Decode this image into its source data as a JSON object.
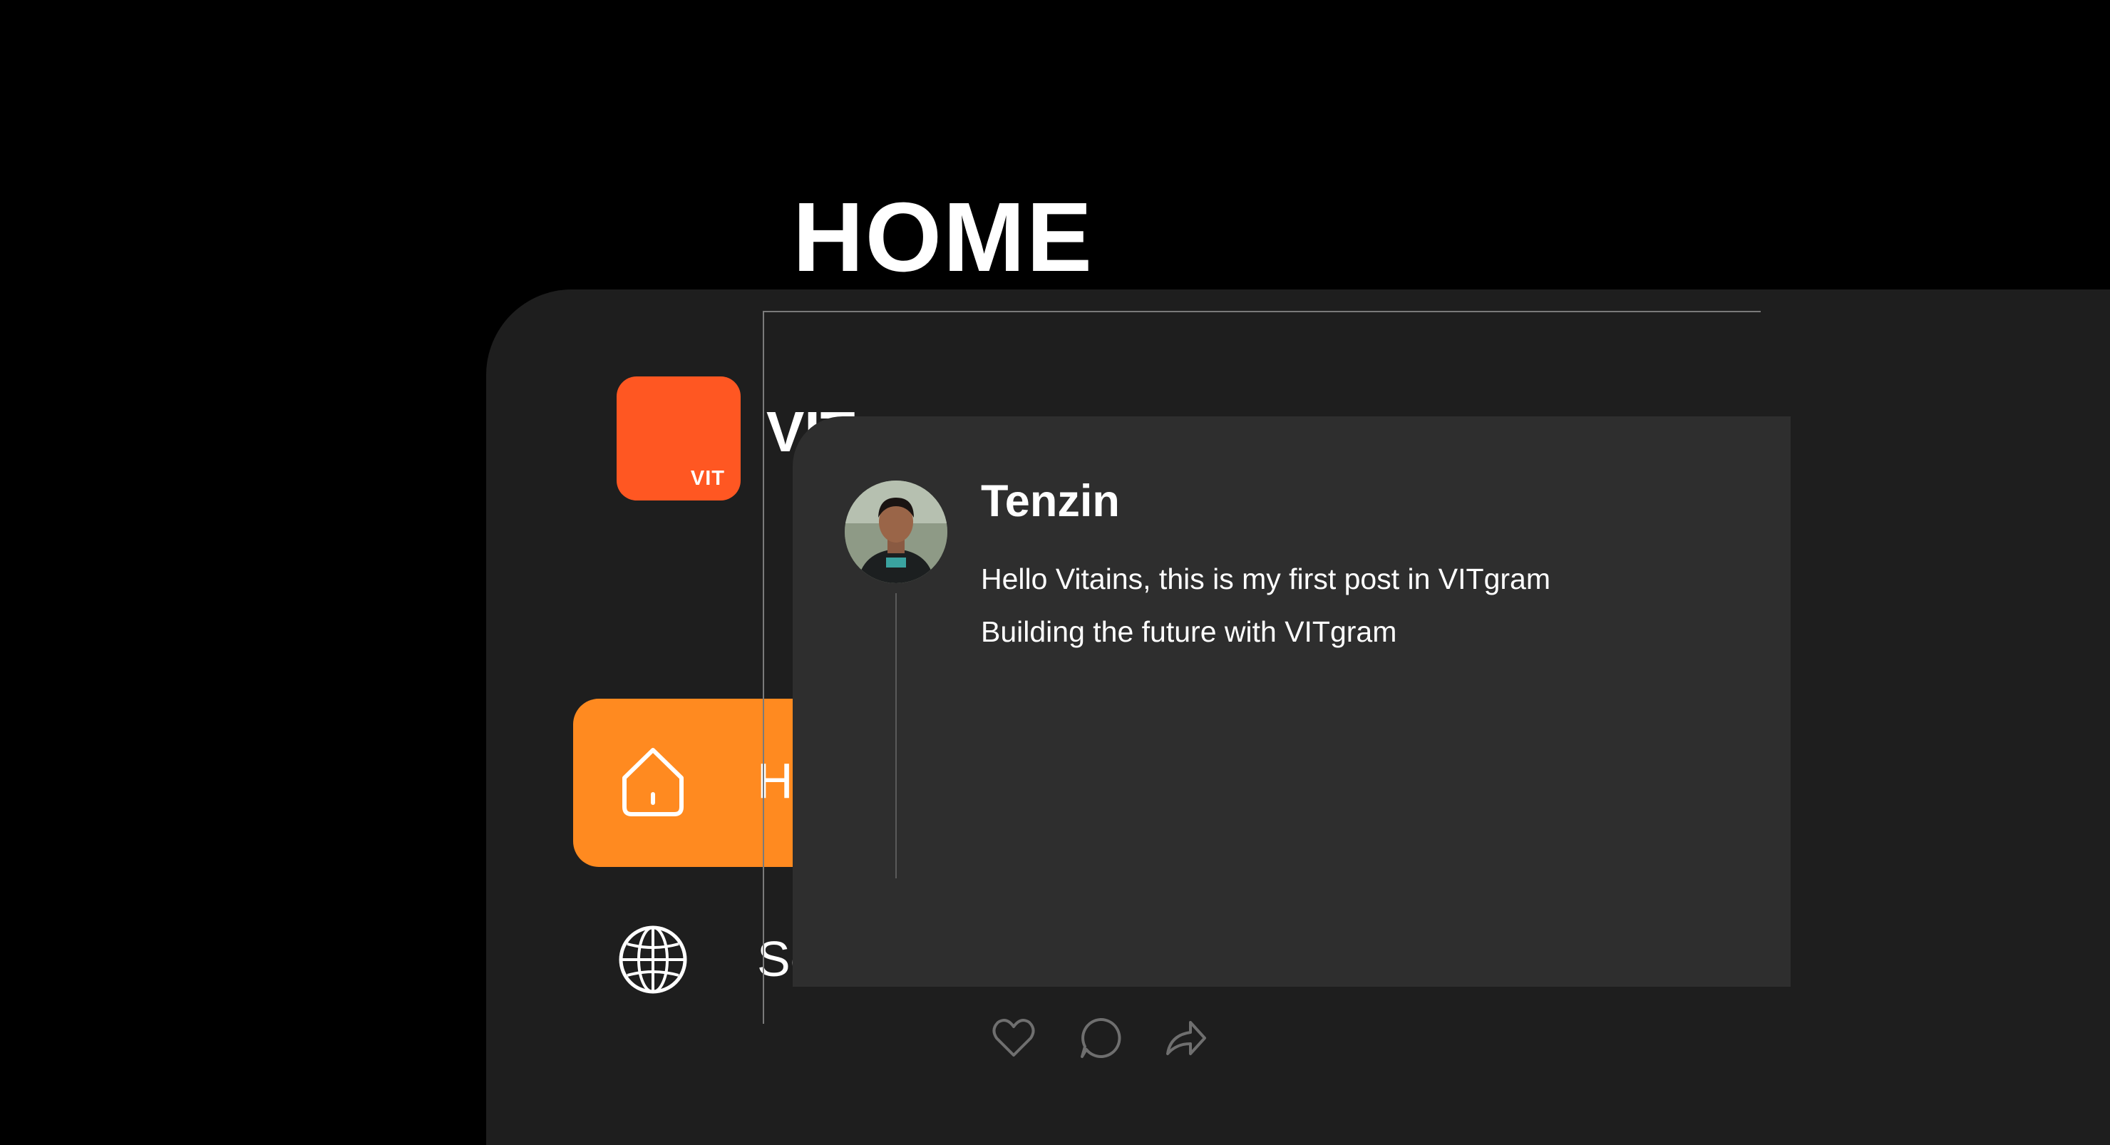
{
  "brand": {
    "logo_text": "VIT",
    "name": "VITgram",
    "logo_color": "#ff5722"
  },
  "page": {
    "title": "HOME"
  },
  "sidebar": {
    "active_color": "#ff8a20",
    "items": [
      {
        "label": "Home",
        "icon": "home-icon",
        "active": true
      },
      {
        "label": "Search",
        "icon": "globe-icon",
        "active": false
      }
    ]
  },
  "post": {
    "author": "Tenzin",
    "lines": [
      "Hello Vitains, this is my first post in VITgram",
      "Building the future with VITgram"
    ],
    "actions": [
      "heart-icon",
      "comment-icon",
      "share-icon"
    ]
  }
}
